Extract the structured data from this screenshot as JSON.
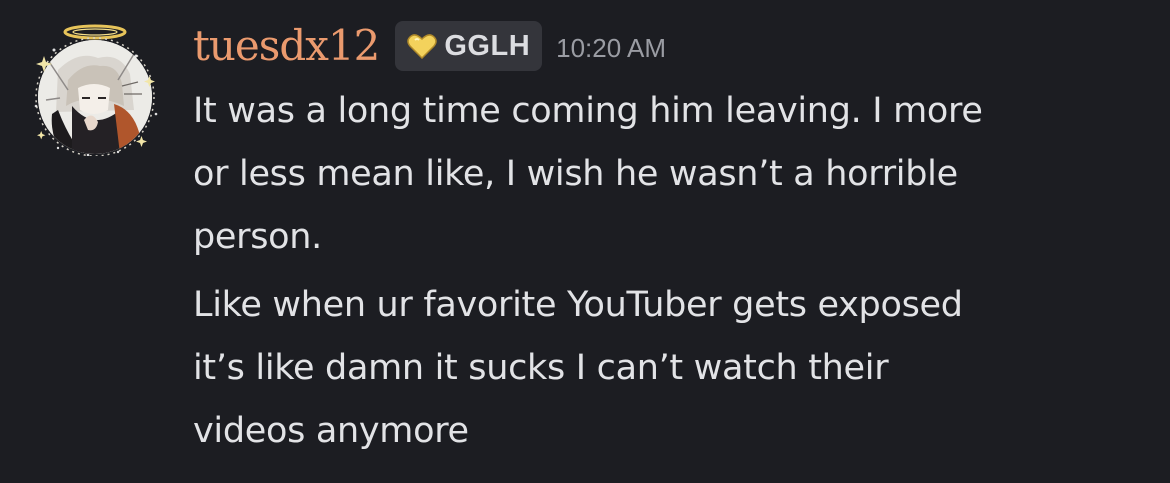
{
  "message": {
    "author": {
      "username": "tuesdx12",
      "username_color": "#ea9a6e",
      "avatar_icon": "anime-character-avatar",
      "avatar_decoration": "halo-sparkle-decoration"
    },
    "server_tag": {
      "icon": "golden-heart-icon",
      "label": "GGLH"
    },
    "timestamp": "10:20 AM",
    "paragraphs": [
      {
        "lines": [
          "It was a long time coming him leaving. I more",
          "or less mean like, I wish he wasn’t a horrible",
          "person."
        ]
      },
      {
        "lines": [
          "Like when ur favorite YouTuber gets exposed",
          "it’s like damn it sucks I can’t watch their",
          "videos anymore"
        ]
      }
    ]
  }
}
